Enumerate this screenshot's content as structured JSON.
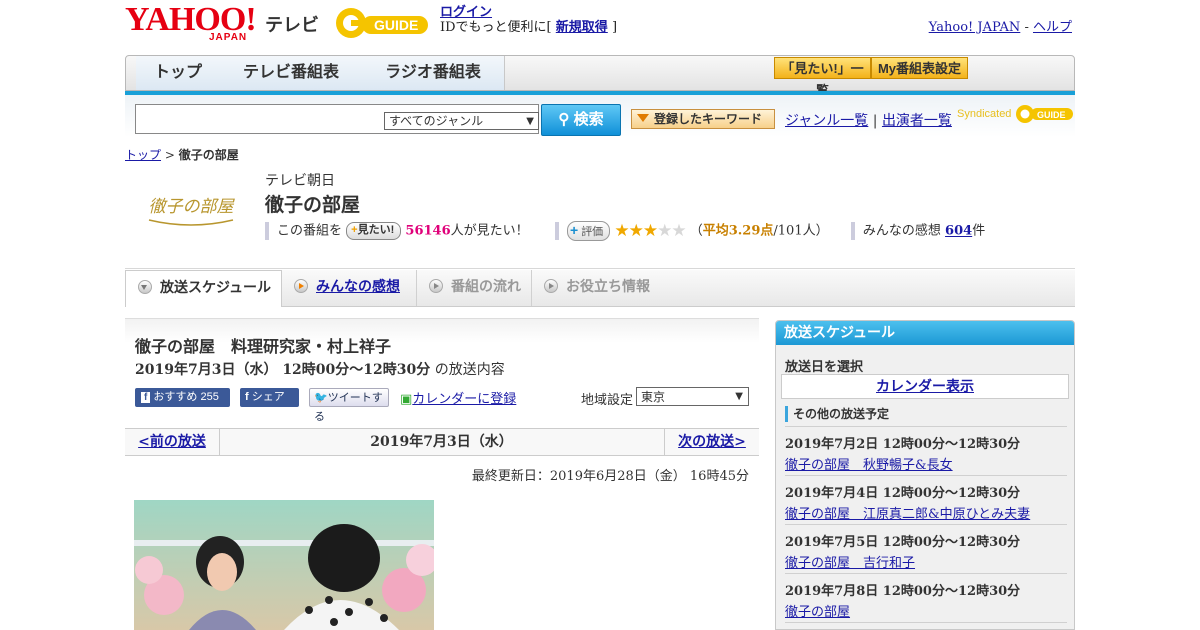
{
  "header": {
    "yahoo": "YAHOO!",
    "japan": "JAPAN",
    "tv": "テレビ",
    "login": "ログイン",
    "login_note_prefix": "IDでもっと便利に[",
    "signup": "新規取得",
    "login_note_suffix": "]",
    "yahoo_japan_link": "Yahoo! JAPAN",
    "sep": "-",
    "help_link": "ヘルプ"
  },
  "nav": {
    "tabs": [
      "トップ",
      "テレビ番組表",
      "ラジオ番組表"
    ],
    "mitai_list": "「見たい!」一覧",
    "my_settings": "My番組表設定"
  },
  "search": {
    "genre_selected": "すべてのジャンル",
    "search_button": "検索",
    "keyword_button": "登録したキーワード",
    "genre_list": "ジャンル一覧",
    "divider": "|",
    "performer_list": "出演者一覧",
    "syndicated": "Syndicated"
  },
  "breadcrumb": {
    "top": "トップ",
    "sep": ">",
    "current": "徹子の部屋"
  },
  "program": {
    "logo_text": "徹子の部屋",
    "channel": "テレビ朝日",
    "title": "徹子の部屋",
    "prefix": "この番組を",
    "mitai_btn": "見たい!",
    "mitai_count": "56146",
    "mitai_suffix": "人が見たい！",
    "eval_btn": "評価",
    "rating": 3.29,
    "rating_open": "（",
    "rating_avg": "平均3.29点",
    "rating_count": "/101人）",
    "impressions_label": "みんなの感想",
    "impressions_count": "604",
    "impressions_unit": "件"
  },
  "subtabs": [
    "放送スケジュール",
    "みんなの感想",
    "番組の流れ",
    "お役立ち情報"
  ],
  "episode": {
    "title": "徹子の部屋　料理研究家・村上祥子",
    "date": "2019年7月3日（水） 12時00分～12時30分",
    "date_suffix": "の放送内容",
    "fb_recommend": "おすすめ 255",
    "fb_share": "シェア",
    "tweet": "ツイートする",
    "calendar": "カレンダーに登録",
    "region_label": "地域設定",
    "region_value": "東京",
    "prev": "<前の放送",
    "current": "2019年7月3日（水）",
    "next": "次の放送>",
    "updated": "最終更新日：2019年6月28日（金）  16時45分"
  },
  "sidebar": {
    "title": "放送スケジュール",
    "select_date": "放送日を選択",
    "calendar_btn": "カレンダー表示",
    "other_title": "その他の放送予定",
    "items": [
      {
        "date": "2019年7月2日  12時00分～12時30分",
        "title": "徹子の部屋　秋野暢子&長女"
      },
      {
        "date": "2019年7月4日  12時00分～12時30分",
        "title": "徹子の部屋　江原真二郎&中原ひとみ夫妻"
      },
      {
        "date": "2019年7月5日  12時00分～12時30分",
        "title": "徹子の部屋　吉行和子"
      },
      {
        "date": "2019年7月8日  12時00分～12時30分",
        "title": "徹子の部屋"
      }
    ]
  },
  "colors": {
    "accent_blue": "#19a0d8",
    "yahoo_red": "#e60012",
    "link": "#1a1aa6",
    "pink": "#e0007a"
  }
}
